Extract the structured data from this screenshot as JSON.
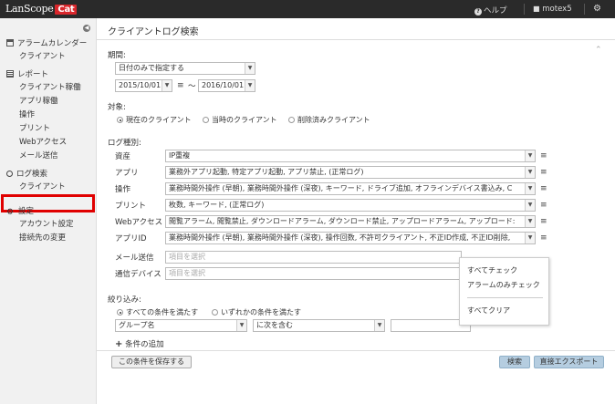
{
  "app": {
    "logo_text": "LanScope",
    "logo_badge": "Cat",
    "help_label": "ヘルプ",
    "user_name": "motex5"
  },
  "colors": {
    "topbar": "#2a2a2a",
    "badge": "#d9262b",
    "highlight_box": "#e00000",
    "primary_button": "#b5cde0"
  },
  "sidebar": {
    "groups": [
      {
        "label": "アラームカレンダー",
        "icon": "calendar-icon",
        "items": [
          "クライアント"
        ]
      },
      {
        "label": "レポート",
        "icon": "report-icon",
        "items": [
          "クライアント稼働",
          "アプリ稼働",
          "操作",
          "プリント",
          "Webアクセス",
          "メール送信"
        ]
      },
      {
        "label": "ログ検索",
        "icon": "search-icon",
        "items": [
          "クライアント"
        ]
      },
      {
        "label": "設定",
        "icon": "gear-icon",
        "items": [
          "アカウント設定",
          "接続先の変更"
        ]
      }
    ]
  },
  "main": {
    "title": "クライアントログ検索",
    "period": {
      "label": "期間:",
      "mode": "日付のみで指定する",
      "from": "2015/10/01",
      "to": "2016/10/01",
      "tilde": "〜"
    },
    "target": {
      "label": "対象:",
      "options": [
        "現在のクライアント",
        "当時のクライアント",
        "削除済みクライアント"
      ],
      "selected": 0
    },
    "logtype": {
      "label": "ログ種別:",
      "rows": [
        {
          "label": "資産",
          "value": "IP重複",
          "placeholder": ""
        },
        {
          "label": "アプリ",
          "value": "業務外アプリ起動, 特定アプリ起動, アプリ禁止, (正常ログ)",
          "placeholder": ""
        },
        {
          "label": "操作",
          "value": "業務時間外操作 (早朝), 業務時間外操作 (深夜), キーワード, ドライブ追加, オフラインデバイス書込み, C",
          "placeholder": ""
        },
        {
          "label": "プリント",
          "value": "枚数, キーワード, (正常ログ)",
          "placeholder": ""
        },
        {
          "label": "Webアクセス",
          "value": "閲覧アラーム, 閲覧禁止, ダウンロードアラーム, ダウンロード禁止, アップロードアラーム, アップロード:",
          "placeholder": ""
        },
        {
          "label": "アプリID",
          "value": "業務時間外操作 (早朝), 業務時間外操作 (深夜), 操作回数, 不許可クライアント, 不正ID作成, 不正ID削除,",
          "placeholder": ""
        },
        {
          "label": "メール送信",
          "value": "",
          "placeholder": "項目を選択"
        },
        {
          "label": "通信デバイス",
          "value": "",
          "placeholder": "項目を選択"
        }
      ]
    },
    "filter": {
      "label": "絞り込み:",
      "options": [
        "すべての条件を満たす",
        "いずれかの条件を満たす"
      ],
      "selected": 0,
      "field": "グループ名",
      "op": "に次を含む",
      "value": "",
      "add_label": "条件の追加"
    },
    "buttons": {
      "save": "この条件を保存する",
      "search": "検索",
      "export": "直接エクスポート"
    },
    "popup": {
      "items": [
        "すべてチェック",
        "アラームのみチェック",
        "すべてクリア"
      ]
    }
  }
}
